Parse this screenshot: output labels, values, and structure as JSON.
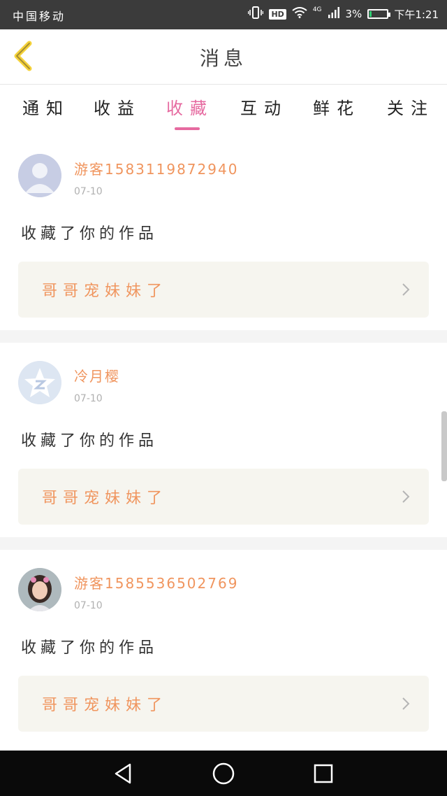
{
  "status_bar": {
    "carrier": "中国移动",
    "network": "4G",
    "hd": "HD",
    "battery": "3%",
    "time": "下午1:21"
  },
  "header": {
    "title": "消息"
  },
  "tabs": [
    {
      "label": "通知",
      "active": false
    },
    {
      "label": "收益",
      "active": false
    },
    {
      "label": "收藏",
      "active": true
    },
    {
      "label": "互动",
      "active": false
    },
    {
      "label": "鲜花",
      "active": false
    },
    {
      "label": "关注",
      "active": false
    }
  ],
  "colors": {
    "accent": "#e66aa0",
    "username": "#f0955e",
    "work_bg": "#f6f5ef",
    "status_bar": "#3b3b3b"
  },
  "messages": [
    {
      "avatar_icon": "default-user-avatar",
      "username": "游客1583119872940",
      "date": "07-10",
      "action": "收藏了你的作品",
      "work_title": "哥哥宠妹妹了"
    },
    {
      "avatar_icon": "qzone-star-avatar",
      "username": "冷月樱",
      "date": "07-10",
      "action": "收藏了你的作品",
      "work_title": "哥哥宠妹妹了"
    },
    {
      "avatar_icon": "girl-photo-avatar",
      "username": "游客1585536502769",
      "date": "07-10",
      "action": "收藏了你的作品",
      "work_title": "哥哥宠妹妹了"
    }
  ]
}
